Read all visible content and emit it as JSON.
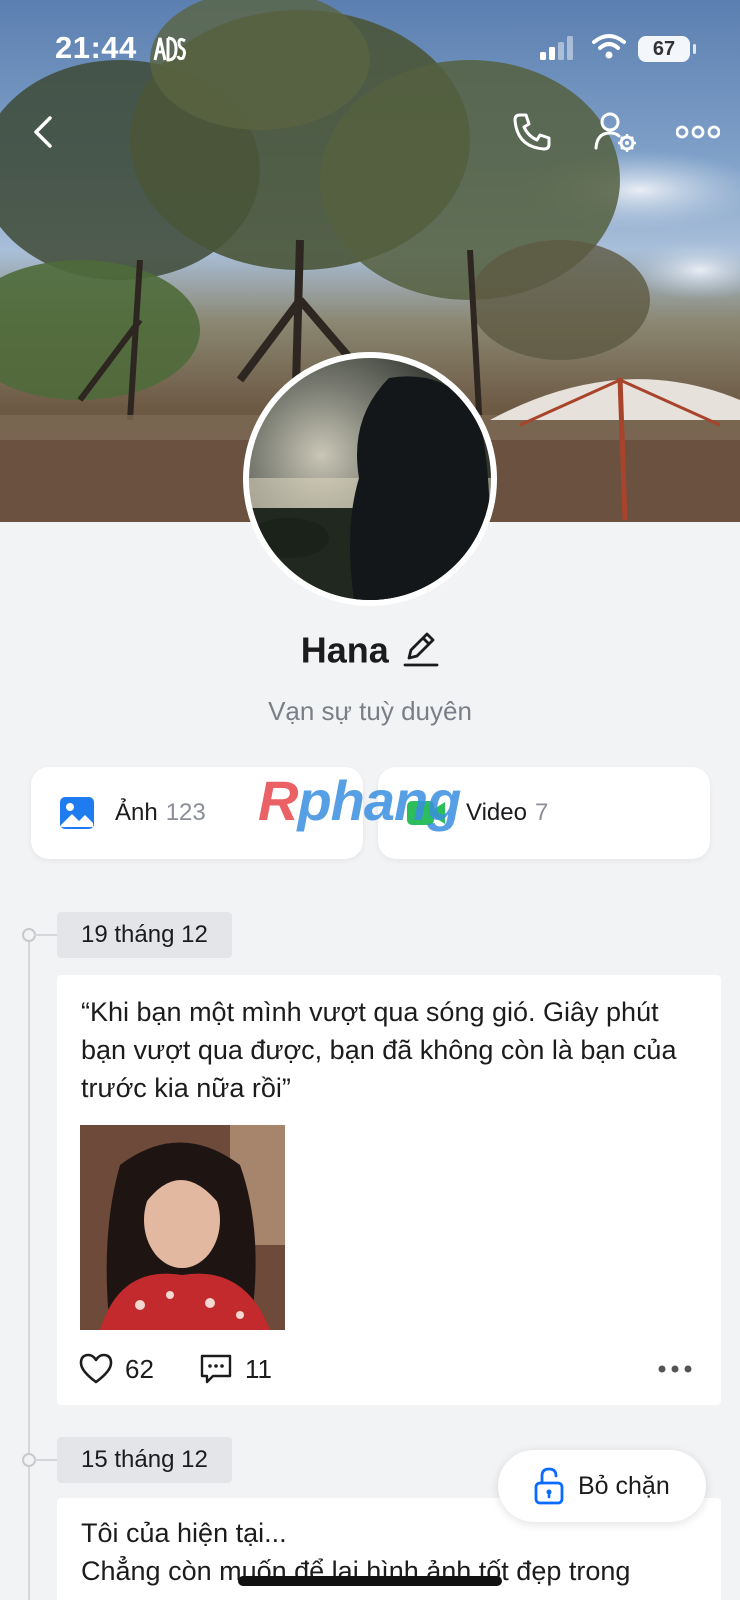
{
  "status_bar": {
    "time": "21:44",
    "battery": "67"
  },
  "profile": {
    "name": "Hana",
    "bio": "Vạn sự tuỳ duyên"
  },
  "media": {
    "photos": {
      "label": "Ảnh",
      "count": "123"
    },
    "videos": {
      "label": "Video",
      "count": "7"
    }
  },
  "watermark": {
    "first": "R",
    "rest": "phang"
  },
  "timeline": [
    {
      "date": "19 tháng 12",
      "text": "“Khi bạn một mình vượt qua sóng gió. Giây phút bạn vượt qua được, bạn đã không còn là bạn của trước kia nữa rồi”",
      "likes": "62",
      "comments": "11"
    },
    {
      "date": "15 tháng 12",
      "text": "Tôi của hiện tại...\nChẳng còn muốn để lại hình ảnh tốt đẹp trong"
    }
  ],
  "unblock": {
    "label": "Bỏ chặn"
  },
  "colors": {
    "accent": "#0a6cff",
    "background": "#f2f3f5",
    "video_green": "#2dbe5c"
  }
}
